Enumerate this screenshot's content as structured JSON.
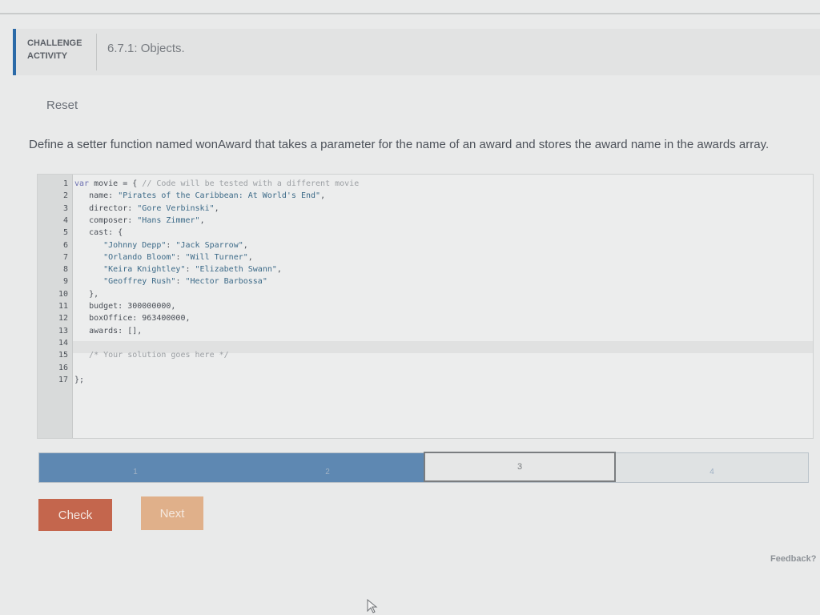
{
  "header": {
    "label_line1": "CHALLENGE",
    "label_line2": "ACTIVITY",
    "title": "6.7.1: Objects."
  },
  "reset_label": "Reset",
  "prompt": "Define a setter function named wonAward that takes a parameter for the name of an award and stores the award name in the awards array.",
  "editor": {
    "line_numbers": [
      "1",
      "2",
      "3",
      "4",
      "5",
      "6",
      "7",
      "8",
      "9",
      "10",
      "11",
      "12",
      "13",
      "14",
      "15",
      "16",
      "17"
    ],
    "lines": [
      {
        "indent": "",
        "parts": [
          {
            "t": "kw",
            "s": "var"
          },
          {
            "t": "",
            "s": " movie = { "
          },
          {
            "t": "cm",
            "s": "// Code will be tested with a different movie"
          }
        ]
      },
      {
        "indent": "   ",
        "parts": [
          {
            "t": "",
            "s": "name: "
          },
          {
            "t": "str",
            "s": "\"Pirates of the Caribbean: At World's End\""
          },
          {
            "t": "",
            "s": ","
          }
        ]
      },
      {
        "indent": "   ",
        "parts": [
          {
            "t": "",
            "s": "director: "
          },
          {
            "t": "str",
            "s": "\"Gore Verbinski\""
          },
          {
            "t": "",
            "s": ","
          }
        ]
      },
      {
        "indent": "   ",
        "parts": [
          {
            "t": "",
            "s": "composer: "
          },
          {
            "t": "str",
            "s": "\"Hans Zimmer\""
          },
          {
            "t": "",
            "s": ","
          }
        ]
      },
      {
        "indent": "   ",
        "parts": [
          {
            "t": "",
            "s": "cast: {"
          }
        ]
      },
      {
        "indent": "      ",
        "parts": [
          {
            "t": "str",
            "s": "\"Johnny Depp\""
          },
          {
            "t": "",
            "s": ": "
          },
          {
            "t": "str",
            "s": "\"Jack Sparrow\""
          },
          {
            "t": "",
            "s": ","
          }
        ]
      },
      {
        "indent": "      ",
        "parts": [
          {
            "t": "str",
            "s": "\"Orlando Bloom\""
          },
          {
            "t": "",
            "s": ": "
          },
          {
            "t": "str",
            "s": "\"Will Turner\""
          },
          {
            "t": "",
            "s": ","
          }
        ]
      },
      {
        "indent": "      ",
        "parts": [
          {
            "t": "str",
            "s": "\"Keira Knightley\""
          },
          {
            "t": "",
            "s": ": "
          },
          {
            "t": "str",
            "s": "\"Elizabeth Swann\""
          },
          {
            "t": "",
            "s": ","
          }
        ]
      },
      {
        "indent": "      ",
        "parts": [
          {
            "t": "str",
            "s": "\"Geoffrey Rush\""
          },
          {
            "t": "",
            "s": ": "
          },
          {
            "t": "str",
            "s": "\"Hector Barbossa\""
          }
        ]
      },
      {
        "indent": "   ",
        "parts": [
          {
            "t": "",
            "s": "},"
          }
        ]
      },
      {
        "indent": "   ",
        "parts": [
          {
            "t": "",
            "s": "budget: 300000000,"
          }
        ]
      },
      {
        "indent": "   ",
        "parts": [
          {
            "t": "",
            "s": "boxOffice: 963400000,"
          }
        ]
      },
      {
        "indent": "   ",
        "parts": [
          {
            "t": "",
            "s": "awards: [],"
          }
        ]
      },
      {
        "indent": "",
        "parts": []
      },
      {
        "indent": "   ",
        "parts": [
          {
            "t": "cm",
            "s": "/* Your solution goes here */"
          }
        ]
      },
      {
        "indent": "",
        "parts": []
      },
      {
        "indent": "",
        "parts": [
          {
            "t": "",
            "s": "};"
          }
        ]
      }
    ]
  },
  "progress": {
    "segments": [
      "1",
      "2",
      "3",
      "4"
    ],
    "completed": 2,
    "current": 3
  },
  "buttons": {
    "check": "Check",
    "next": "Next"
  },
  "feedback_label": "Feedback?",
  "colors": {
    "accent_blue": "#2b6aa8",
    "progress_fill": "#5e88b2",
    "check_button": "#c4664d",
    "next_button": "#e0b08a"
  }
}
